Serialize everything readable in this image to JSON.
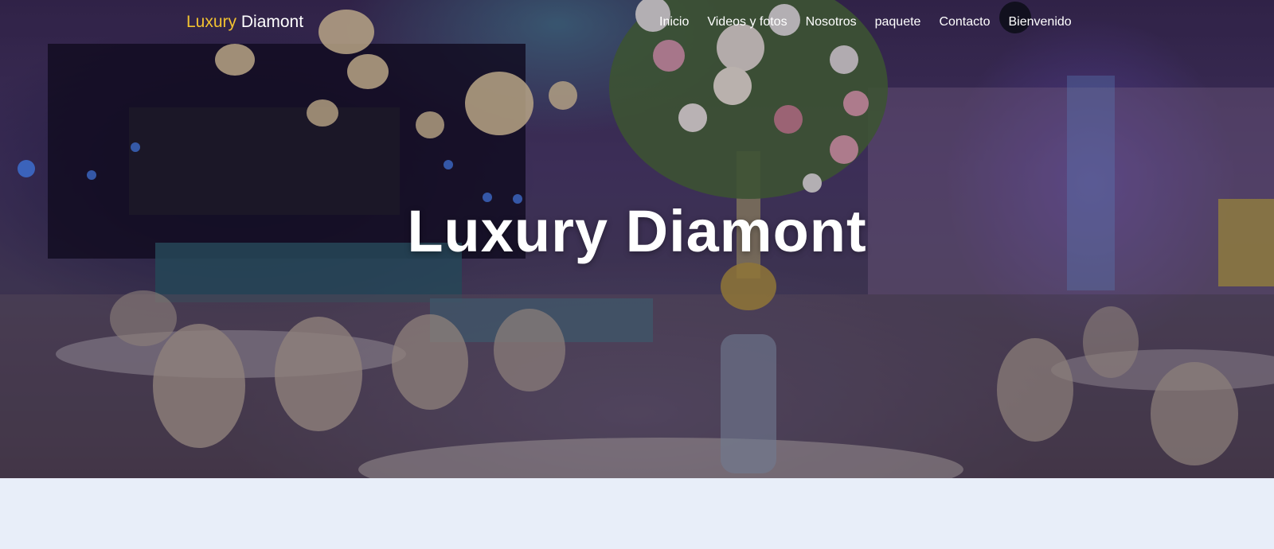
{
  "brand": {
    "accent": "Luxury",
    "rest": " Diamont"
  },
  "nav": {
    "items": [
      "Inicio",
      "Videos y fotos",
      "Nosotros",
      "paquete",
      "Contacto",
      "Bienvenido"
    ]
  },
  "hero": {
    "title": "Luxury Diamont"
  },
  "colors": {
    "accent": "#f2c230",
    "nav_text": "#ffffff",
    "page_bg": "#e8eef9"
  }
}
